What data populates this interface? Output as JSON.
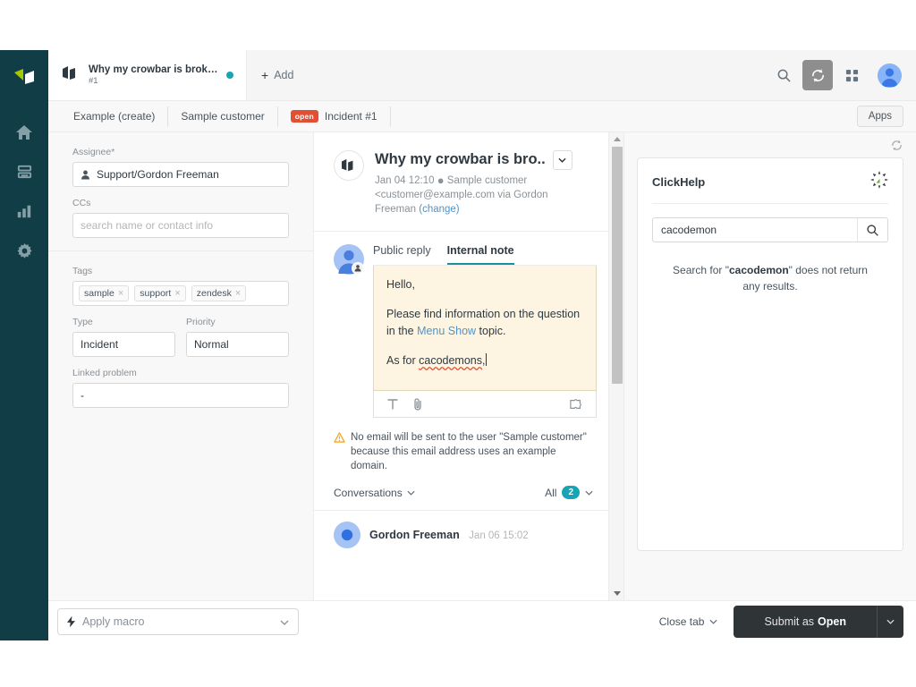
{
  "nav": {
    "items": [
      {
        "name": "zendesk-logo",
        "label": "Zendesk"
      },
      {
        "name": "home",
        "label": "Home"
      },
      {
        "name": "views",
        "label": "Views"
      },
      {
        "name": "reporting",
        "label": "Reporting"
      },
      {
        "name": "admin",
        "label": "Admin"
      }
    ]
  },
  "tabbar": {
    "active_tab": {
      "title": "Why my crowbar is broken?",
      "subtitle": "#1"
    },
    "add_label": "Add",
    "add_plus": "+",
    "icons": [
      "search-icon",
      "refresh-icon",
      "apps-grid-icon",
      "user-avatar"
    ]
  },
  "breadcrumb": {
    "items": [
      "Example (create)",
      "Sample customer"
    ],
    "status_badge": "open",
    "current": "Incident #1",
    "apps_label": "Apps"
  },
  "left_panel": {
    "assignee_label": "Assignee*",
    "assignee_value": "Support/Gordon Freeman",
    "ccs_label": "CCs",
    "ccs_placeholder": "search name or contact info",
    "tags_label": "Tags",
    "tags": [
      "sample",
      "support",
      "zendesk"
    ],
    "tag_remove": "×",
    "type_label": "Type",
    "type_value": "Incident",
    "priority_label": "Priority",
    "priority_value": "Normal",
    "linked_problem_label": "Linked problem",
    "linked_problem_value": "-"
  },
  "ticket": {
    "title": "Why my crowbar is bro..",
    "date": "Jan 04 12:10",
    "separator": "●",
    "requester": "Sample customer",
    "email": "<customer@example.com via",
    "via_agent": "Gordon Freeman",
    "change_link": "(change)",
    "tabs": [
      {
        "label": "Public reply",
        "selected": false
      },
      {
        "label": "Internal note",
        "selected": true
      }
    ],
    "note": {
      "greeting": "Hello,",
      "body_before_link": "Please find information on the question in the ",
      "link_text": "Menu Show",
      "body_after_link": " topic.",
      "line3_before": "As for ",
      "line3_misspelled": "cacodemons",
      "line3_after": ","
    },
    "toolbar_icons": [
      "text-format-icon",
      "attachment-icon",
      "apps-puzzle-icon"
    ],
    "warning": "No email will be sent to the user \"Sample customer\" because this email address uses an example domain.",
    "conversations_label": "Conversations",
    "filter_label": "All",
    "filter_count": "2",
    "comment": {
      "author": "Gordon Freeman",
      "date": "Jan 06 15:02"
    }
  },
  "clickhelp": {
    "title": "ClickHelp",
    "search_value": "cacodemon",
    "search_placeholder": "Search",
    "empty_prefix": "Search for \"",
    "empty_term": "cacodemon",
    "empty_suffix": "\" does not return any results."
  },
  "bottom": {
    "macro_label": "Apply macro",
    "close_tab_label": "Close tab",
    "submit_prefix": "Submit as",
    "submit_status": "Open"
  },
  "colors": {
    "nav_bg": "#113d46",
    "accent_teal": "#17a5b5",
    "status_open": "#e34f32",
    "note_bg": "#fdf5e2",
    "link": "#5293c7",
    "submit_bg": "#2f3437"
  }
}
